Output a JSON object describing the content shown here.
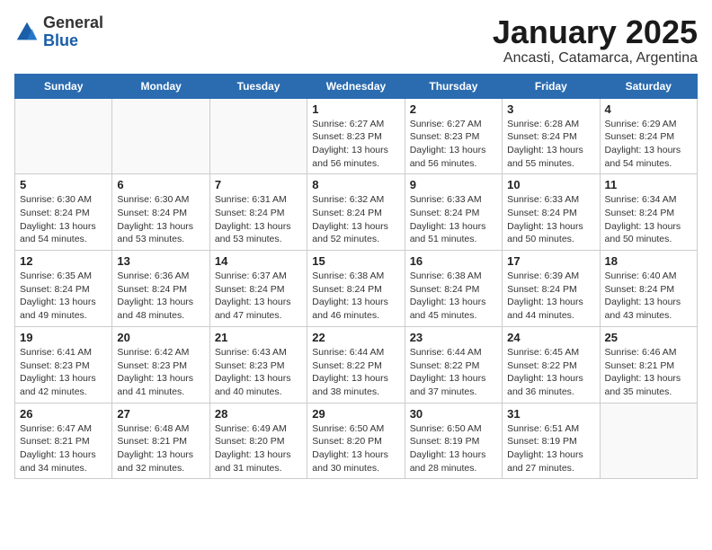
{
  "logo": {
    "general": "General",
    "blue": "Blue"
  },
  "title": "January 2025",
  "subtitle": "Ancasti, Catamarca, Argentina",
  "headers": [
    "Sunday",
    "Monday",
    "Tuesday",
    "Wednesday",
    "Thursday",
    "Friday",
    "Saturday"
  ],
  "weeks": [
    [
      {
        "day": "",
        "info": ""
      },
      {
        "day": "",
        "info": ""
      },
      {
        "day": "",
        "info": ""
      },
      {
        "day": "1",
        "info": "Sunrise: 6:27 AM\nSunset: 8:23 PM\nDaylight: 13 hours and 56 minutes."
      },
      {
        "day": "2",
        "info": "Sunrise: 6:27 AM\nSunset: 8:23 PM\nDaylight: 13 hours and 56 minutes."
      },
      {
        "day": "3",
        "info": "Sunrise: 6:28 AM\nSunset: 8:24 PM\nDaylight: 13 hours and 55 minutes."
      },
      {
        "day": "4",
        "info": "Sunrise: 6:29 AM\nSunset: 8:24 PM\nDaylight: 13 hours and 54 minutes."
      }
    ],
    [
      {
        "day": "5",
        "info": "Sunrise: 6:30 AM\nSunset: 8:24 PM\nDaylight: 13 hours and 54 minutes."
      },
      {
        "day": "6",
        "info": "Sunrise: 6:30 AM\nSunset: 8:24 PM\nDaylight: 13 hours and 53 minutes."
      },
      {
        "day": "7",
        "info": "Sunrise: 6:31 AM\nSunset: 8:24 PM\nDaylight: 13 hours and 53 minutes."
      },
      {
        "day": "8",
        "info": "Sunrise: 6:32 AM\nSunset: 8:24 PM\nDaylight: 13 hours and 52 minutes."
      },
      {
        "day": "9",
        "info": "Sunrise: 6:33 AM\nSunset: 8:24 PM\nDaylight: 13 hours and 51 minutes."
      },
      {
        "day": "10",
        "info": "Sunrise: 6:33 AM\nSunset: 8:24 PM\nDaylight: 13 hours and 50 minutes."
      },
      {
        "day": "11",
        "info": "Sunrise: 6:34 AM\nSunset: 8:24 PM\nDaylight: 13 hours and 50 minutes."
      }
    ],
    [
      {
        "day": "12",
        "info": "Sunrise: 6:35 AM\nSunset: 8:24 PM\nDaylight: 13 hours and 49 minutes."
      },
      {
        "day": "13",
        "info": "Sunrise: 6:36 AM\nSunset: 8:24 PM\nDaylight: 13 hours and 48 minutes."
      },
      {
        "day": "14",
        "info": "Sunrise: 6:37 AM\nSunset: 8:24 PM\nDaylight: 13 hours and 47 minutes."
      },
      {
        "day": "15",
        "info": "Sunrise: 6:38 AM\nSunset: 8:24 PM\nDaylight: 13 hours and 46 minutes."
      },
      {
        "day": "16",
        "info": "Sunrise: 6:38 AM\nSunset: 8:24 PM\nDaylight: 13 hours and 45 minutes."
      },
      {
        "day": "17",
        "info": "Sunrise: 6:39 AM\nSunset: 8:24 PM\nDaylight: 13 hours and 44 minutes."
      },
      {
        "day": "18",
        "info": "Sunrise: 6:40 AM\nSunset: 8:24 PM\nDaylight: 13 hours and 43 minutes."
      }
    ],
    [
      {
        "day": "19",
        "info": "Sunrise: 6:41 AM\nSunset: 8:23 PM\nDaylight: 13 hours and 42 minutes."
      },
      {
        "day": "20",
        "info": "Sunrise: 6:42 AM\nSunset: 8:23 PM\nDaylight: 13 hours and 41 minutes."
      },
      {
        "day": "21",
        "info": "Sunrise: 6:43 AM\nSunset: 8:23 PM\nDaylight: 13 hours and 40 minutes."
      },
      {
        "day": "22",
        "info": "Sunrise: 6:44 AM\nSunset: 8:22 PM\nDaylight: 13 hours and 38 minutes."
      },
      {
        "day": "23",
        "info": "Sunrise: 6:44 AM\nSunset: 8:22 PM\nDaylight: 13 hours and 37 minutes."
      },
      {
        "day": "24",
        "info": "Sunrise: 6:45 AM\nSunset: 8:22 PM\nDaylight: 13 hours and 36 minutes."
      },
      {
        "day": "25",
        "info": "Sunrise: 6:46 AM\nSunset: 8:21 PM\nDaylight: 13 hours and 35 minutes."
      }
    ],
    [
      {
        "day": "26",
        "info": "Sunrise: 6:47 AM\nSunset: 8:21 PM\nDaylight: 13 hours and 34 minutes."
      },
      {
        "day": "27",
        "info": "Sunrise: 6:48 AM\nSunset: 8:21 PM\nDaylight: 13 hours and 32 minutes."
      },
      {
        "day": "28",
        "info": "Sunrise: 6:49 AM\nSunset: 8:20 PM\nDaylight: 13 hours and 31 minutes."
      },
      {
        "day": "29",
        "info": "Sunrise: 6:50 AM\nSunset: 8:20 PM\nDaylight: 13 hours and 30 minutes."
      },
      {
        "day": "30",
        "info": "Sunrise: 6:50 AM\nSunset: 8:19 PM\nDaylight: 13 hours and 28 minutes."
      },
      {
        "day": "31",
        "info": "Sunrise: 6:51 AM\nSunset: 8:19 PM\nDaylight: 13 hours and 27 minutes."
      },
      {
        "day": "",
        "info": ""
      }
    ]
  ]
}
